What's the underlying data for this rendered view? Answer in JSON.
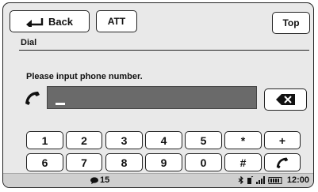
{
  "toolbar": {
    "back_label": "Back",
    "att_label": "ATT",
    "top_label": "Top"
  },
  "screen": {
    "title": "Dial",
    "prompt": "Please input phone number.",
    "phone_number": ""
  },
  "keypad": {
    "row1": [
      "1",
      "2",
      "3",
      "4",
      "5",
      "*",
      "+"
    ],
    "row2": [
      "6",
      "7",
      "8",
      "9",
      "0",
      "#"
    ]
  },
  "status": {
    "messages_count": "15",
    "time": "12:00"
  },
  "icons": {
    "back": "return-arrow-icon",
    "handset": "phone-handset-icon",
    "delete": "backspace-icon",
    "call": "phone-handset-icon",
    "messages": "chat-bubble-icon",
    "signal": "signal-strength-icon",
    "battery": "battery-icon"
  }
}
